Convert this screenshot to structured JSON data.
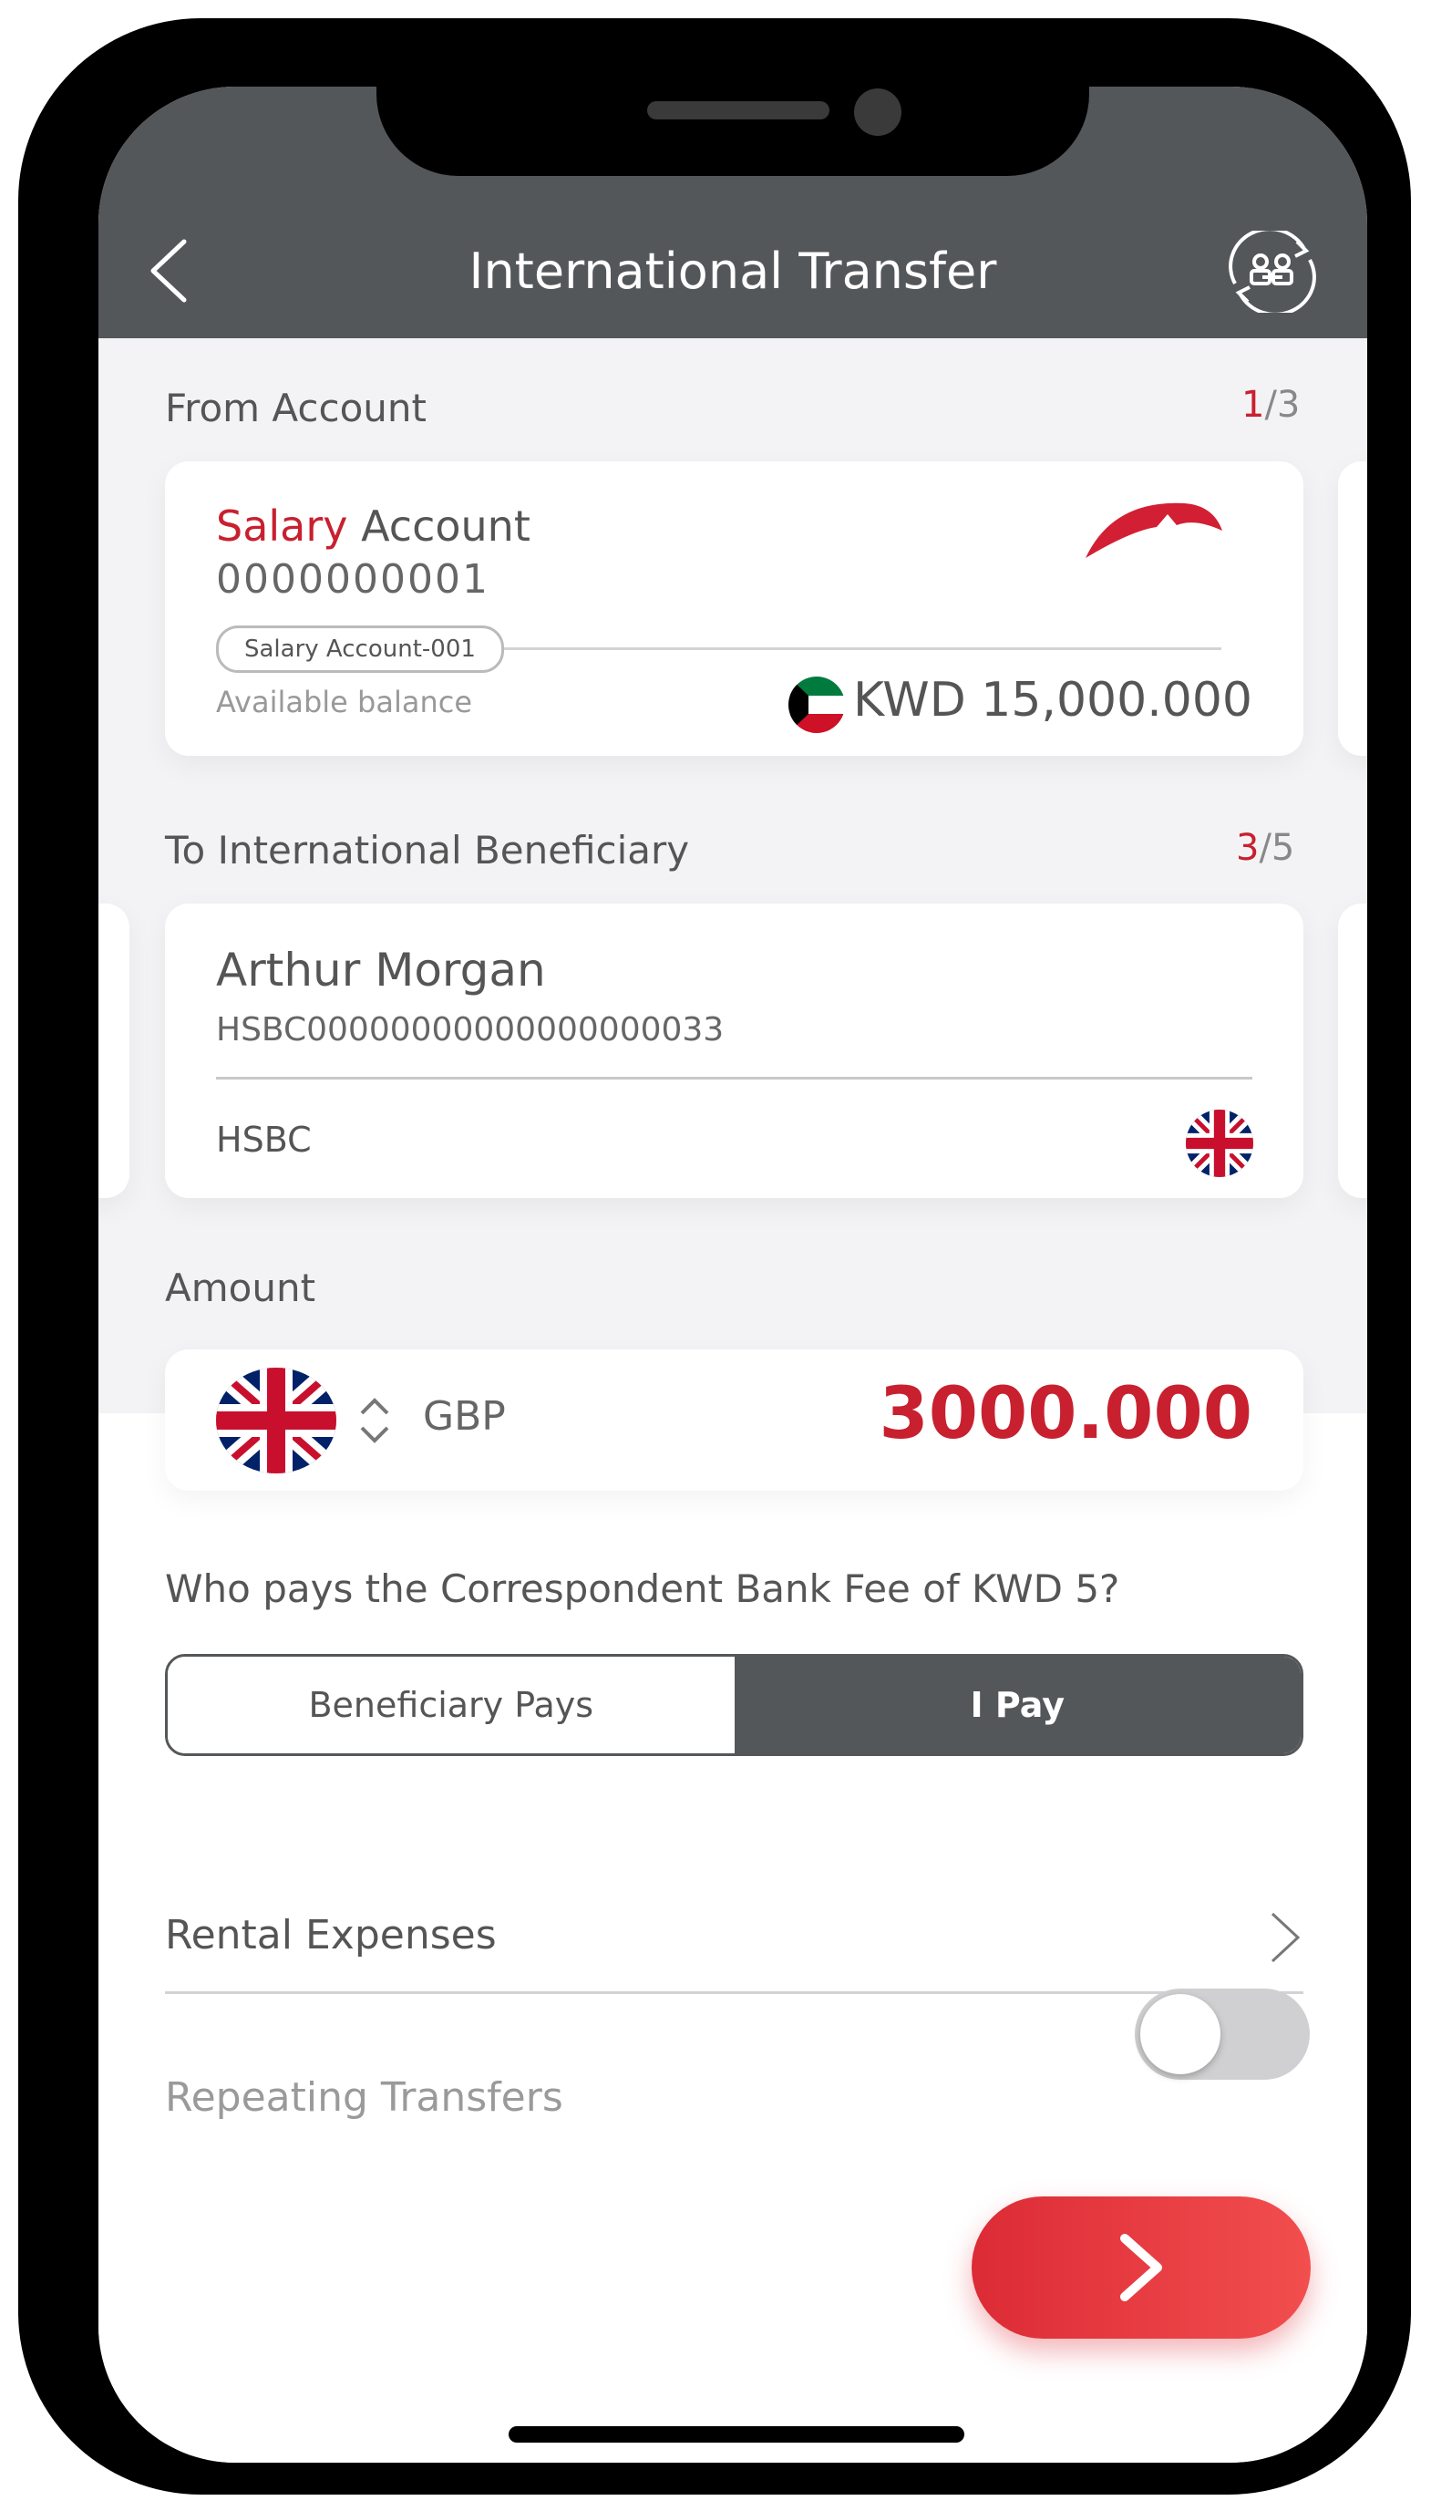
{
  "header": {
    "title": "International Transfer",
    "background": "#54575a"
  },
  "from_account": {
    "section_label": "From Account",
    "counter_current": "1",
    "counter_total": "/3",
    "card": {
      "name_highlight": "Salary",
      "name_rest": " Account",
      "number": "0000000001",
      "tag": "Salary Account-001",
      "balance_label": "Available balance",
      "balance_value": "KWD 15,000.000",
      "flag_icon": "kuwait-flag-icon",
      "logo_icon": "bank-logo-icon"
    }
  },
  "to_beneficiary": {
    "section_label": "To International Beneficiary",
    "counter_current": "3",
    "counter_total": "/5",
    "card": {
      "name": "Arthur Morgan",
      "iban": "HSBC00000000000000000033",
      "bank": "HSBC",
      "flag_icon": "uk-flag-icon"
    }
  },
  "amount": {
    "section_label": "Amount",
    "currency": "GBP",
    "value": "3000.000",
    "flag_icon": "uk-flag-icon",
    "value_color": "#c8202f"
  },
  "fee": {
    "question": "Who pays the Correspondent Bank Fee of KWD 5?",
    "options": [
      "Beneficiary Pays",
      "I Pay"
    ],
    "selected": "I Pay"
  },
  "purpose": {
    "label": "Rental Expenses"
  },
  "repeating": {
    "label": "Repeating Transfers",
    "enabled": false
  },
  "accent_color": "#c8202f"
}
